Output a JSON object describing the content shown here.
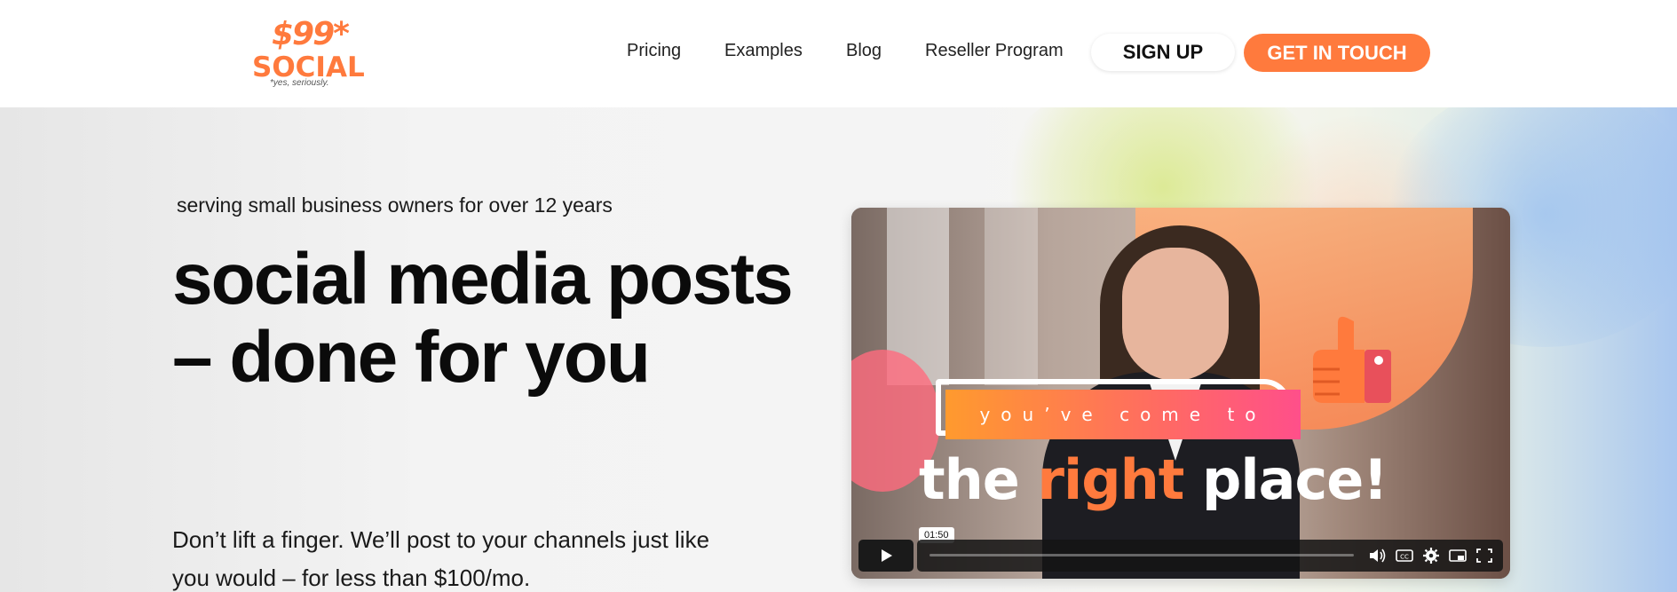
{
  "header": {
    "logo": {
      "price": "$99*",
      "word": "SOCIAL",
      "tagline": "*yes, seriously."
    },
    "nav": [
      {
        "label": "Pricing"
      },
      {
        "label": "Examples"
      },
      {
        "label": "Blog"
      },
      {
        "label": "Reseller Program"
      }
    ],
    "signup_label": "SIGN UP",
    "contact_label": "GET IN TOUCH",
    "accent_color": "#ff7a3d"
  },
  "hero": {
    "eyebrow": "serving small business owners for over 12 years",
    "headline": "social media posts – done for you",
    "subtext": "Don’t lift a finger. We’ll post to your channels just like you would – for less than $100/mo."
  },
  "video": {
    "banner_text": "you’ve come to",
    "big_text_part1": "the",
    "big_text_highlight": "right",
    "big_text_part2": "place!",
    "timestamp": "01:50",
    "progress": 0,
    "controls": [
      "play-icon",
      "volume-icon",
      "captions-icon",
      "settings-icon",
      "pip-icon",
      "fullscreen-icon"
    ]
  }
}
